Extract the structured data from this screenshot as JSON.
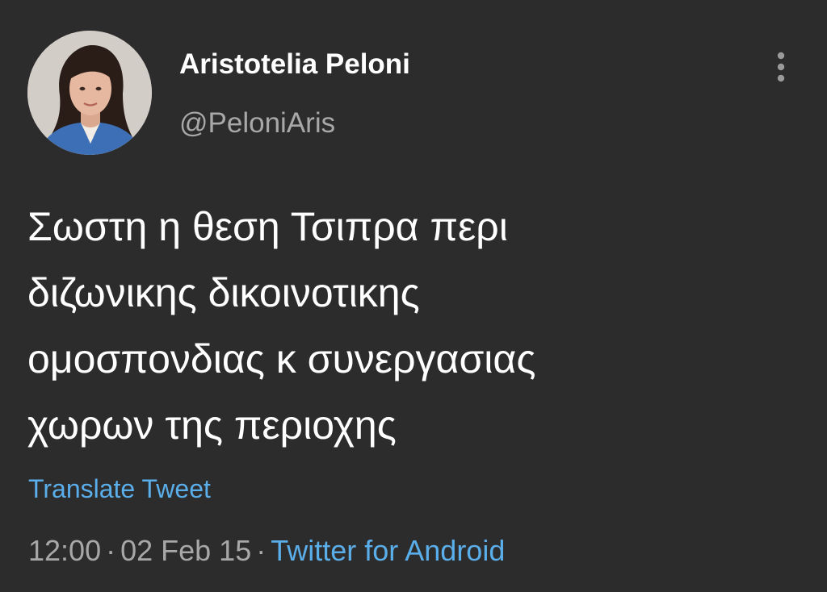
{
  "tweet": {
    "author": {
      "display_name": "Aristotelia Peloni",
      "handle": "@PeloniAris",
      "avatar": "profile-photo"
    },
    "more_icon": "more-vertical-icon",
    "text_lines": [
      "Σωστη η θεση Τσιπρα περι",
      "διζωνικης δικοινοτικης",
      "ομοσπονδιας κ συνεργασιας",
      "χωρων της περιοχης"
    ],
    "translate_label": "Translate Tweet",
    "time": "12:00",
    "date": "02 Feb 15",
    "separator": "·",
    "source": "Twitter for Android"
  },
  "colors": {
    "background": "#2d2c2d",
    "text": "#ffffff",
    "secondary_text": "#a8a8a8",
    "link": "#5aaee9"
  }
}
